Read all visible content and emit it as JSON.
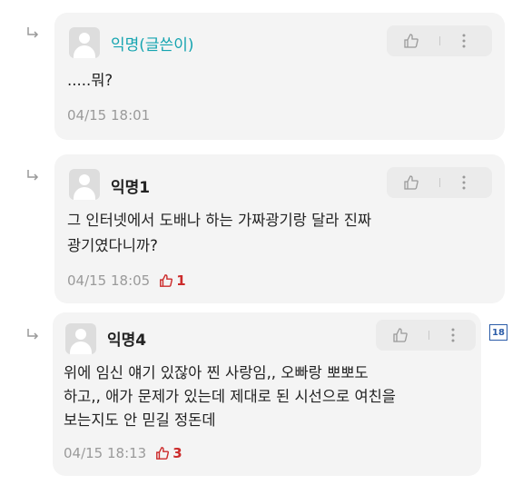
{
  "comments": [
    {
      "author": "익명(글쓴이)",
      "lines": [
        ".....뭐?"
      ],
      "timestamp": "04/15 18:01",
      "likes": null
    },
    {
      "author": "익명1",
      "lines": [
        "그 인터넷에서 도배나 하는 가짜광기랑 달라 진짜",
        "광기였다니까?"
      ],
      "timestamp": "04/15 18:05",
      "likes": "1"
    },
    {
      "author": "익명4",
      "lines": [
        "위에 임신 얘기 있잖아 찐 사랑임,, 오빠랑 뽀뽀도",
        "하고,, 애가 문제가 있는데 제대로 된 시선으로 여친을",
        "보는지도 안 믿길 정돈데"
      ],
      "timestamp": "04/15 18:13",
      "likes": "3"
    }
  ],
  "page_badge": "18",
  "colors": {
    "op_author": "#15a4b0",
    "like_red": "#cc2b2b",
    "badge_blue": "#2b5ca8"
  },
  "icons": [
    "reply-arrow-icon",
    "avatar-icon",
    "thumbs-up-icon",
    "more-vertical-icon"
  ]
}
